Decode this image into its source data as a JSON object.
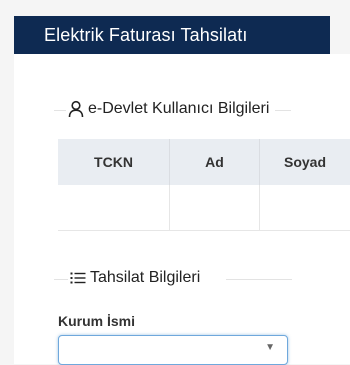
{
  "header": {
    "title": "Elektrik Faturası Tahsilatı"
  },
  "edevlet_section": {
    "title": "e-Devlet Kullanıcı Bilgileri",
    "icon": "user-icon",
    "table": {
      "columns": [
        "TCKN",
        "Ad",
        "Soyad"
      ],
      "rows": [
        [
          "",
          "",
          ""
        ]
      ]
    }
  },
  "tahsilat_section": {
    "title": "Tahsilat Bilgileri",
    "icon": "list-icon",
    "kurum_label": "Kurum İsmi",
    "kurum_value": ""
  },
  "colors": {
    "header_bg": "#0e2a52",
    "table_header_bg": "#e9edf2",
    "focus_border": "#6fa8dc"
  }
}
